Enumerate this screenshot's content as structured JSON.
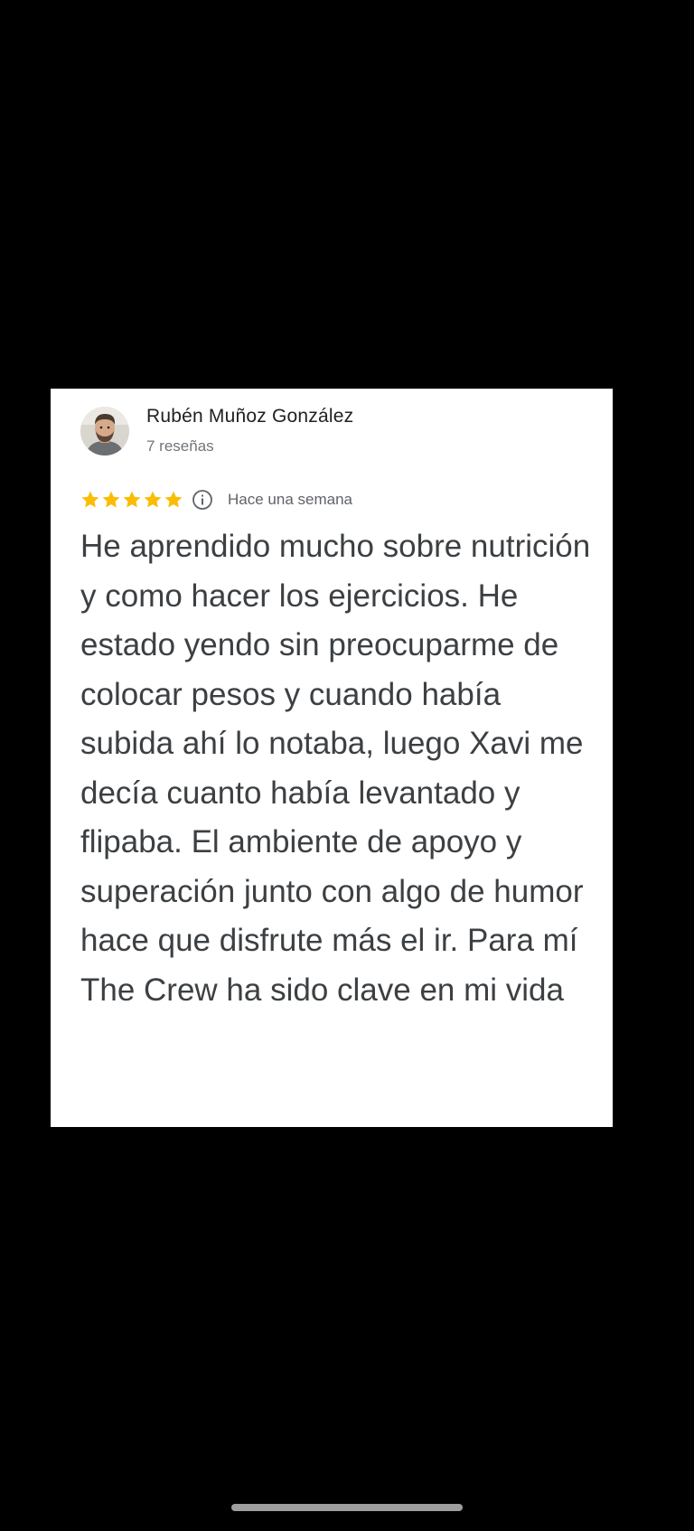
{
  "review": {
    "author_name": "Rubén Muñoz González",
    "author_reviews": "7 reseñas",
    "rating": 5,
    "rating_max": 5,
    "time_ago": "Hace una semana",
    "text": "He aprendido mucho sobre nutrición y como hacer los ejercicios. He estado yendo sin preocuparme de colocar pesos y cuando había subida ahí lo notaba, luego Xavi me decía cuanto había levantado y flipaba. El ambiente de apoyo y superación junto con algo de humor hace que disfrute más el ir. Para mí The Crew ha sido clave en mi vida"
  },
  "icons": {
    "avatar": "avatar-photo",
    "star": "star-icon",
    "info": "info-icon"
  },
  "colors": {
    "background": "#000000",
    "card": "#ffffff",
    "star": "#fbbc04",
    "author_name": "#202124",
    "secondary_text": "#70757a",
    "review_text": "#3c4043"
  }
}
